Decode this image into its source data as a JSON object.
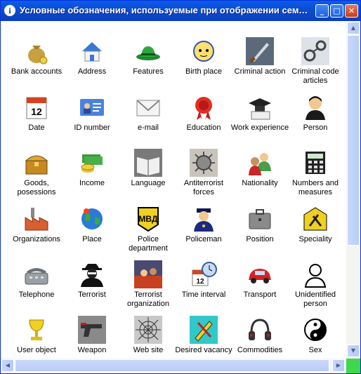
{
  "window": {
    "title": "Условные обозначения, используемые при отображении семан…",
    "app_icon": "i",
    "minimize": "_",
    "maximize": "□",
    "close": "✕"
  },
  "scroll": {
    "up": "▲",
    "down": "▼",
    "left": "◀",
    "right": "▶"
  },
  "items": [
    {
      "label": "Bank accounts",
      "icon": "money-bag-icon"
    },
    {
      "label": "Address",
      "icon": "house-icon"
    },
    {
      "label": "Features",
      "icon": "hat-icon"
    },
    {
      "label": "Birth place",
      "icon": "baby-face-icon"
    },
    {
      "label": "Criminal action",
      "icon": "knife-icon"
    },
    {
      "label": "Criminal code articles",
      "icon": "handcuffs-icon"
    },
    {
      "label": "Date",
      "icon": "calendar-icon"
    },
    {
      "label": "ID number",
      "icon": "id-card-icon"
    },
    {
      "label": "e-mail",
      "icon": "envelope-icon"
    },
    {
      "label": "Education",
      "icon": "diploma-seal-icon"
    },
    {
      "label": "Work experience",
      "icon": "graduation-cap-icon"
    },
    {
      "label": "Person",
      "icon": "person-icon"
    },
    {
      "label": "Goods, posessions",
      "icon": "treasure-chest-icon"
    },
    {
      "label": "Income",
      "icon": "coins-icon"
    },
    {
      "label": "Language",
      "icon": "book-icon"
    },
    {
      "label": "Antiterrorist forces",
      "icon": "shield-arrows-icon"
    },
    {
      "label": "Nationality",
      "icon": "people-icon"
    },
    {
      "label": "Numbers and measures",
      "icon": "calculator-icon"
    },
    {
      "label": "Organizations",
      "icon": "factory-icon"
    },
    {
      "label": "Place",
      "icon": "globe-icon"
    },
    {
      "label": "Police department",
      "icon": "police-badge-icon"
    },
    {
      "label": "Policeman",
      "icon": "policeman-icon"
    },
    {
      "label": "Position",
      "icon": "briefcase-icon"
    },
    {
      "label": "Speciality",
      "icon": "tools-icon"
    },
    {
      "label": "Telephone",
      "icon": "telephone-icon"
    },
    {
      "label": "Terrorist",
      "icon": "terrorist-icon"
    },
    {
      "label": "Terrorist organization",
      "icon": "terrorist-organization-icon"
    },
    {
      "label": "Time interval",
      "icon": "clock-calendar-icon"
    },
    {
      "label": "Transport",
      "icon": "car-icon"
    },
    {
      "label": "Unidentified person",
      "icon": "unknown-person-icon"
    },
    {
      "label": "User object",
      "icon": "trophy-icon"
    },
    {
      "label": "Weapon",
      "icon": "pistol-icon"
    },
    {
      "label": "Web site",
      "icon": "spider-web-icon"
    },
    {
      "label": "Desired vacancy",
      "icon": "pencil-tools-icon"
    },
    {
      "label": "Commodities",
      "icon": "headphones-icon"
    },
    {
      "label": "Sex",
      "icon": "yin-yang-icon"
    }
  ]
}
